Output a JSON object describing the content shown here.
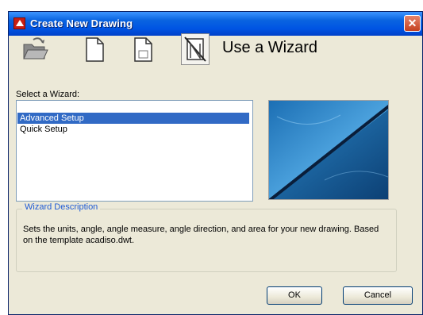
{
  "dialog": {
    "title": "Create New Drawing",
    "close_symbol": "✕"
  },
  "toolbar": {
    "icons": [
      "open-folder-icon",
      "blank-document-icon",
      "template-document-icon",
      "wizard-icon"
    ],
    "mode_title": "Use a Wizard"
  },
  "wizard": {
    "select_label": "Select a Wizard:",
    "options": [
      "Advanced Setup",
      "Quick Setup"
    ],
    "selected": "Advanced Setup"
  },
  "description": {
    "caption": "Wizard Description",
    "text": "Sets the units, angle, angle measure, angle direction, and area for your new drawing. Based on the template acadiso.dwt."
  },
  "buttons": {
    "ok": "OK",
    "cancel": "Cancel"
  },
  "colors": {
    "titlebar": "#0054e3",
    "selection": "#316ac5",
    "caption": "#1e5ad6",
    "dialog_bg": "#ece9d8"
  }
}
